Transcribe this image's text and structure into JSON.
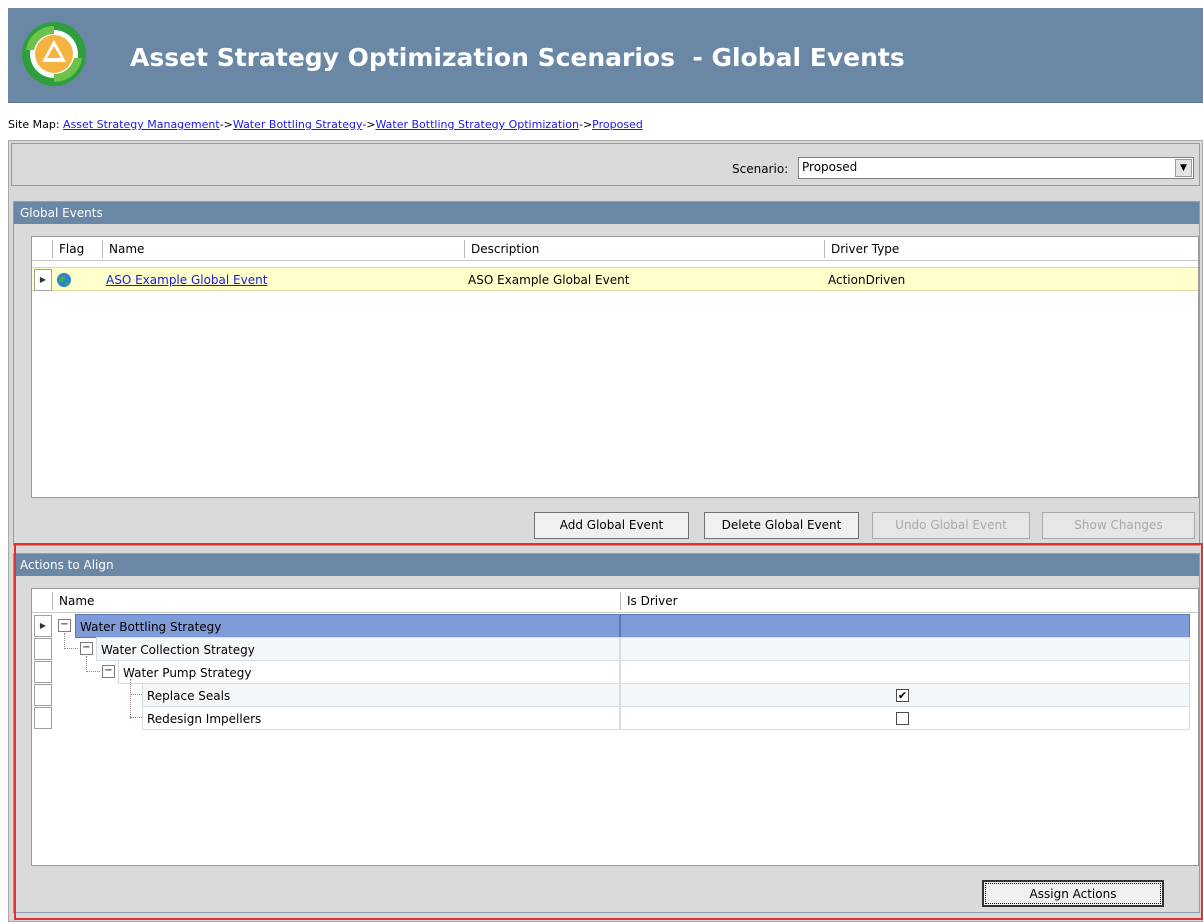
{
  "header": {
    "title": "Asset Strategy Optimization Scenarios  - Global Events"
  },
  "sitemap": {
    "label": "Site Map:",
    "links": [
      "Asset Strategy Management",
      "Water Bottling Strategy",
      "Water Bottling Strategy Optimization",
      "Proposed"
    ],
    "separator": "->"
  },
  "scenario": {
    "label": "Scenario:",
    "value": "Proposed"
  },
  "global_events": {
    "title": "Global Events",
    "columns": [
      "Flag",
      "Name",
      "Description",
      "Driver Type"
    ],
    "rows": [
      {
        "name": "ASO Example Global Event",
        "description": "ASO Example Global Event",
        "driver_type": "ActionDriven"
      }
    ],
    "buttons": {
      "add": "Add Global Event",
      "delete": "Delete Global Event",
      "undo": "Undo Global Event",
      "show_changes": "Show Changes"
    }
  },
  "actions": {
    "title": "Actions to Align",
    "columns": [
      "Name",
      "Is Driver"
    ],
    "tree": [
      {
        "label": "Water Bottling Strategy"
      },
      {
        "label": "Water Collection Strategy"
      },
      {
        "label": "Water Pump Strategy"
      },
      {
        "label": "Replace Seals",
        "is_driver": true
      },
      {
        "label": "Redesign Impellers",
        "is_driver": false
      }
    ],
    "buttons": {
      "assign": "Assign Actions"
    }
  },
  "colors": {
    "header_bg": "#6a88a6",
    "selected_row": "#7f9bd8",
    "highlight_row": "#ffffcc",
    "outline": "#e03030"
  }
}
